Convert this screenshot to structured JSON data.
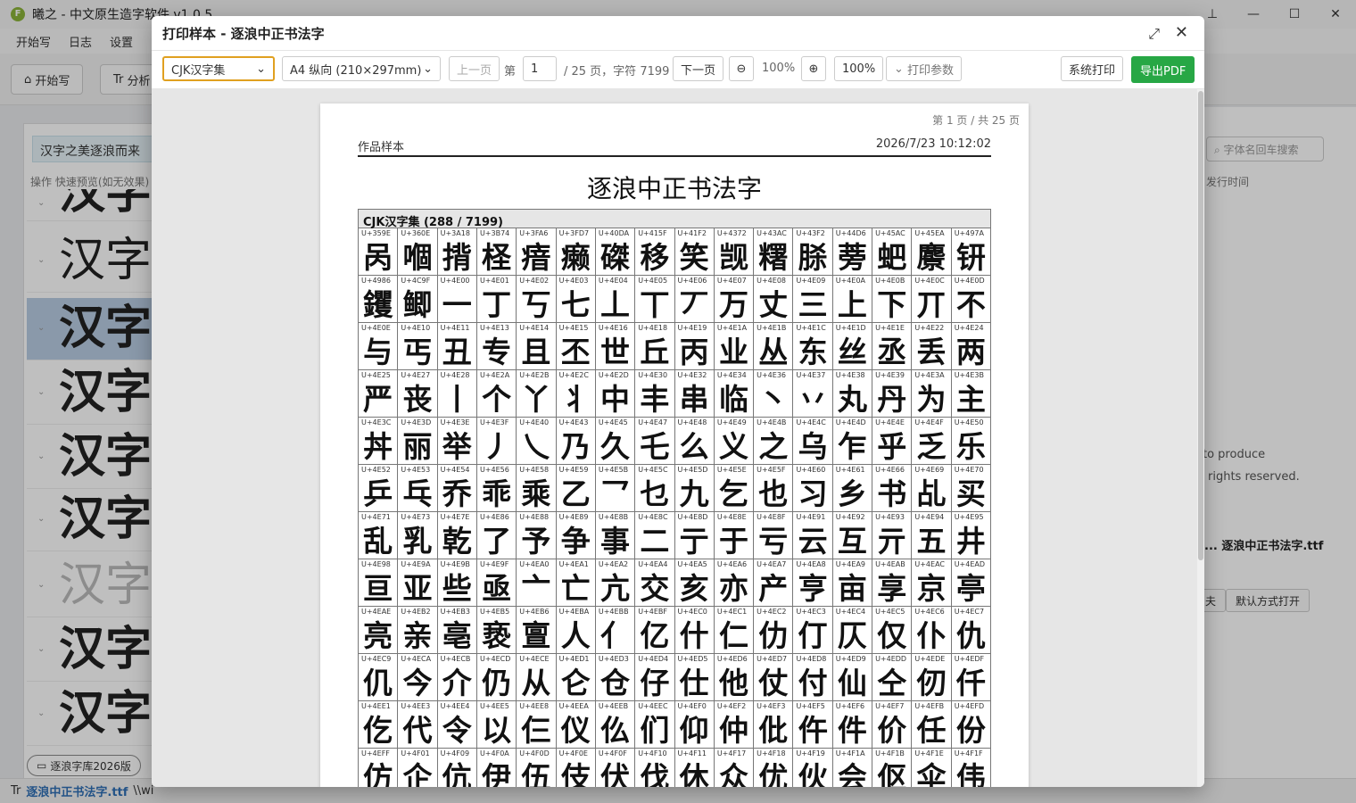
{
  "app": {
    "title": "曦之 - 中文原生造字软件 v1.0.5",
    "logo_letter": "F",
    "menu": [
      "开始写",
      "日志",
      "设置"
    ],
    "win_buttons": [
      "pin-icon",
      "minimize-icon",
      "maximize-icon",
      "close-icon"
    ]
  },
  "toolbar": {
    "start_label": "开始写",
    "analyze_label": "分析"
  },
  "left": {
    "preview_text": "汉字之美逐浪而来",
    "ops_text": "操作   快速预览(如无效果)",
    "samples": [
      "汉字之",
      "汉字之",
      "汉字之",
      "汉字之",
      "汉字之",
      "汉字之",
      "汉字之",
      "汉字之",
      "汉字之"
    ],
    "tag_label": "逐浪字库2026版"
  },
  "right": {
    "search_placeholder": "字体名回车搜索",
    "col_label": "发行时间",
    "text1": "to produce",
    "text2": "rights reserved.",
    "file_label": "... 逐浪中正书法字.ttf",
    "btn1": "夫",
    "btn2": "默认方式打开"
  },
  "status": {
    "file": "逐浪中正书法字.ttf",
    "path": "\\\\wi"
  },
  "modal": {
    "title": "打印样本 - 逐浪中正书法字",
    "charset_select": "CJK汉字集",
    "paper_select": "A4 纵向 (210×297mm)",
    "prev_label": "上一页",
    "page_prefix": "第",
    "page_value": "1",
    "page_suffix": "/ 25 页，字符 7199",
    "next_label": "下一页",
    "zoom_value": "100%",
    "zoom_input": "100%",
    "print_params": "打印参数",
    "system_print": "系统打印",
    "export_pdf": "导出PDF",
    "accent": "#27a745"
  },
  "paper": {
    "page_indicator": "第 1 页 / 共 25 页",
    "header_left": "作品样本",
    "header_right": "2026/7/23 10:12:02",
    "title": "逐浪中正书法字",
    "section_label": "CJK汉字集 (288 / 7199)",
    "cells": [
      [
        "U+359E",
        "呙"
      ],
      [
        "U+360E",
        "嗰"
      ],
      [
        "U+3A18",
        "揹"
      ],
      [
        "U+3B74",
        "柽"
      ],
      [
        "U+3FA6",
        "瘖"
      ],
      [
        "U+3FD7",
        "癞"
      ],
      [
        "U+40DA",
        "磔"
      ],
      [
        "U+415F",
        "移"
      ],
      [
        "U+41F2",
        "笑"
      ],
      [
        "U+4372",
        "觊"
      ],
      [
        "U+43AC",
        "糬"
      ],
      [
        "U+43F2",
        "脎"
      ],
      [
        "U+44D6",
        "蒡"
      ],
      [
        "U+45AC",
        "蚆"
      ],
      [
        "U+45EA",
        "麖"
      ],
      [
        "U+497A",
        "钘"
      ],
      [
        "U+4986",
        "钁"
      ],
      [
        "U+4C9F",
        "鲫"
      ],
      [
        "U+4E00",
        "一"
      ],
      [
        "U+4E01",
        "丁"
      ],
      [
        "U+4E02",
        "丂"
      ],
      [
        "U+4E03",
        "七"
      ],
      [
        "U+4E04",
        "丄"
      ],
      [
        "U+4E05",
        "丅"
      ],
      [
        "U+4E06",
        "丆"
      ],
      [
        "U+4E07",
        "万"
      ],
      [
        "U+4E08",
        "丈"
      ],
      [
        "U+4E09",
        "三"
      ],
      [
        "U+4E0A",
        "上"
      ],
      [
        "U+4E0B",
        "下"
      ],
      [
        "U+4E0C",
        "丌"
      ],
      [
        "U+4E0D",
        "不"
      ],
      [
        "U+4E0E",
        "与"
      ],
      [
        "U+4E10",
        "丐"
      ],
      [
        "U+4E11",
        "丑"
      ],
      [
        "U+4E13",
        "专"
      ],
      [
        "U+4E14",
        "且"
      ],
      [
        "U+4E15",
        "丕"
      ],
      [
        "U+4E16",
        "世"
      ],
      [
        "U+4E18",
        "丘"
      ],
      [
        "U+4E19",
        "丙"
      ],
      [
        "U+4E1A",
        "业"
      ],
      [
        "U+4E1B",
        "丛"
      ],
      [
        "U+4E1C",
        "东"
      ],
      [
        "U+4E1D",
        "丝"
      ],
      [
        "U+4E1E",
        "丞"
      ],
      [
        "U+4E22",
        "丢"
      ],
      [
        "U+4E24",
        "两"
      ],
      [
        "U+4E25",
        "严"
      ],
      [
        "U+4E27",
        "丧"
      ],
      [
        "U+4E28",
        "丨"
      ],
      [
        "U+4E2A",
        "个"
      ],
      [
        "U+4E2B",
        "丫"
      ],
      [
        "U+4E2C",
        "丬"
      ],
      [
        "U+4E2D",
        "中"
      ],
      [
        "U+4E30",
        "丰"
      ],
      [
        "U+4E32",
        "串"
      ],
      [
        "U+4E34",
        "临"
      ],
      [
        "U+4E36",
        "丶"
      ],
      [
        "U+4E37",
        "丷"
      ],
      [
        "U+4E38",
        "丸"
      ],
      [
        "U+4E39",
        "丹"
      ],
      [
        "U+4E3A",
        "为"
      ],
      [
        "U+4E3B",
        "主"
      ],
      [
        "U+4E3C",
        "丼"
      ],
      [
        "U+4E3D",
        "丽"
      ],
      [
        "U+4E3E",
        "举"
      ],
      [
        "U+4E3F",
        "丿"
      ],
      [
        "U+4E40",
        "乀"
      ],
      [
        "U+4E43",
        "乃"
      ],
      [
        "U+4E45",
        "久"
      ],
      [
        "U+4E47",
        "乇"
      ],
      [
        "U+4E48",
        "么"
      ],
      [
        "U+4E49",
        "义"
      ],
      [
        "U+4E4B",
        "之"
      ],
      [
        "U+4E4C",
        "乌"
      ],
      [
        "U+4E4D",
        "乍"
      ],
      [
        "U+4E4E",
        "乎"
      ],
      [
        "U+4E4F",
        "乏"
      ],
      [
        "U+4E50",
        "乐"
      ],
      [
        "U+4E52",
        "乒"
      ],
      [
        "U+4E53",
        "乓"
      ],
      [
        "U+4E54",
        "乔"
      ],
      [
        "U+4E56",
        "乖"
      ],
      [
        "U+4E58",
        "乘"
      ],
      [
        "U+4E59",
        "乙"
      ],
      [
        "U+4E5B",
        "乛"
      ],
      [
        "U+4E5C",
        "乜"
      ],
      [
        "U+4E5D",
        "九"
      ],
      [
        "U+4E5E",
        "乞"
      ],
      [
        "U+4E5F",
        "也"
      ],
      [
        "U+4E60",
        "习"
      ],
      [
        "U+4E61",
        "乡"
      ],
      [
        "U+4E66",
        "书"
      ],
      [
        "U+4E69",
        "乩"
      ],
      [
        "U+4E70",
        "买"
      ],
      [
        "U+4E71",
        "乱"
      ],
      [
        "U+4E73",
        "乳"
      ],
      [
        "U+4E7E",
        "乾"
      ],
      [
        "U+4E86",
        "了"
      ],
      [
        "U+4E88",
        "予"
      ],
      [
        "U+4E89",
        "争"
      ],
      [
        "U+4E8B",
        "事"
      ],
      [
        "U+4E8C",
        "二"
      ],
      [
        "U+4E8D",
        "亍"
      ],
      [
        "U+4E8E",
        "于"
      ],
      [
        "U+4E8F",
        "亏"
      ],
      [
        "U+4E91",
        "云"
      ],
      [
        "U+4E92",
        "互"
      ],
      [
        "U+4E93",
        "亓"
      ],
      [
        "U+4E94",
        "五"
      ],
      [
        "U+4E95",
        "井"
      ],
      [
        "U+4E98",
        "亘"
      ],
      [
        "U+4E9A",
        "亚"
      ],
      [
        "U+4E9B",
        "些"
      ],
      [
        "U+4E9F",
        "亟"
      ],
      [
        "U+4EA0",
        "亠"
      ],
      [
        "U+4EA1",
        "亡"
      ],
      [
        "U+4EA2",
        "亢"
      ],
      [
        "U+4EA4",
        "交"
      ],
      [
        "U+4EA5",
        "亥"
      ],
      [
        "U+4EA6",
        "亦"
      ],
      [
        "U+4EA7",
        "产"
      ],
      [
        "U+4EA8",
        "亨"
      ],
      [
        "U+4EA9",
        "亩"
      ],
      [
        "U+4EAB",
        "享"
      ],
      [
        "U+4EAC",
        "京"
      ],
      [
        "U+4EAD",
        "亭"
      ],
      [
        "U+4EAE",
        "亮"
      ],
      [
        "U+4EB2",
        "亲"
      ],
      [
        "U+4EB3",
        "亳"
      ],
      [
        "U+4EB5",
        "亵"
      ],
      [
        "U+4EB6",
        "亶"
      ],
      [
        "U+4EBA",
        "人"
      ],
      [
        "U+4EBB",
        "亻"
      ],
      [
        "U+4EBF",
        "亿"
      ],
      [
        "U+4EC0",
        "什"
      ],
      [
        "U+4EC1",
        "仁"
      ],
      [
        "U+4EC2",
        "仂"
      ],
      [
        "U+4EC3",
        "仃"
      ],
      [
        "U+4EC4",
        "仄"
      ],
      [
        "U+4EC5",
        "仅"
      ],
      [
        "U+4EC6",
        "仆"
      ],
      [
        "U+4EC7",
        "仇"
      ],
      [
        "U+4EC9",
        "仉"
      ],
      [
        "U+4ECA",
        "今"
      ],
      [
        "U+4ECB",
        "介"
      ],
      [
        "U+4ECD",
        "仍"
      ],
      [
        "U+4ECE",
        "从"
      ],
      [
        "U+4ED1",
        "仑"
      ],
      [
        "U+4ED3",
        "仓"
      ],
      [
        "U+4ED4",
        "仔"
      ],
      [
        "U+4ED5",
        "仕"
      ],
      [
        "U+4ED6",
        "他"
      ],
      [
        "U+4ED7",
        "仗"
      ],
      [
        "U+4ED8",
        "付"
      ],
      [
        "U+4ED9",
        "仙"
      ],
      [
        "U+4EDD",
        "仝"
      ],
      [
        "U+4EDE",
        "仞"
      ],
      [
        "U+4EDF",
        "仟"
      ],
      [
        "U+4EE1",
        "仡"
      ],
      [
        "U+4EE3",
        "代"
      ],
      [
        "U+4EE4",
        "令"
      ],
      [
        "U+4EE5",
        "以"
      ],
      [
        "U+4EE8",
        "仨"
      ],
      [
        "U+4EEA",
        "仪"
      ],
      [
        "U+4EEB",
        "仫"
      ],
      [
        "U+4EEC",
        "们"
      ],
      [
        "U+4EF0",
        "仰"
      ],
      [
        "U+4EF2",
        "仲"
      ],
      [
        "U+4EF3",
        "仳"
      ],
      [
        "U+4EF5",
        "仵"
      ],
      [
        "U+4EF6",
        "件"
      ],
      [
        "U+4EF7",
        "价"
      ],
      [
        "U+4EFB",
        "任"
      ],
      [
        "U+4EFD",
        "份"
      ],
      [
        "U+4EFF",
        "仿"
      ],
      [
        "U+4F01",
        "企"
      ],
      [
        "U+4F09",
        "伉"
      ],
      [
        "U+4F0A",
        "伊"
      ],
      [
        "U+4F0D",
        "伍"
      ],
      [
        "U+4F0E",
        "伎"
      ],
      [
        "U+4F0F",
        "伏"
      ],
      [
        "U+4F10",
        "伐"
      ],
      [
        "U+4F11",
        "休"
      ],
      [
        "U+4F17",
        "众"
      ],
      [
        "U+4F18",
        "优"
      ],
      [
        "U+4F19",
        "伙"
      ],
      [
        "U+4F1A",
        "会"
      ],
      [
        "U+4F1B",
        "伛"
      ],
      [
        "U+4F1E",
        "伞"
      ],
      [
        "U+4F1F",
        "伟"
      ]
    ]
  }
}
